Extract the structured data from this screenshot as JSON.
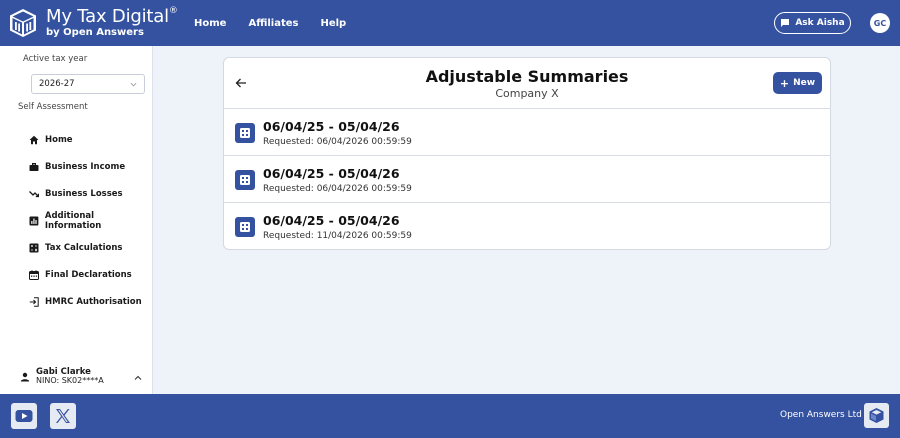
{
  "app": {
    "title": "My Tax Digital",
    "registered": "®",
    "subtitle": "by Open Answers"
  },
  "nav": {
    "items": [
      {
        "label": "Home"
      },
      {
        "label": "Affiliates"
      },
      {
        "label": "Help"
      }
    ]
  },
  "header": {
    "ask_label": "Ask Aisha",
    "user_initials": "GC"
  },
  "sidebar": {
    "tax_year_label": "Active tax year",
    "tax_year_value": "2026-27",
    "section_label": "Self Assessment",
    "items": [
      {
        "label": "Home",
        "icon": "home-icon"
      },
      {
        "label": "Business Income",
        "icon": "briefcase-icon"
      },
      {
        "label": "Business Losses",
        "icon": "trending-down-icon"
      },
      {
        "label": "Additional Information",
        "icon": "bar-chart-icon"
      },
      {
        "label": "Tax Calculations",
        "icon": "calculator-icon"
      },
      {
        "label": "Final Declarations",
        "icon": "calendar-icon"
      },
      {
        "label": "HMRC Authorisation",
        "icon": "login-icon"
      }
    ],
    "user": {
      "name": "Gabi Clarke",
      "nino": "NINO: SK02****A"
    }
  },
  "main": {
    "title": "Adjustable Summaries",
    "subtitle": "Company X",
    "new_button_label": "New",
    "summaries": [
      {
        "period": "06/04/25 - 05/04/26",
        "requested": "Requested: 06/04/2026 00:59:59"
      },
      {
        "period": "06/04/25 - 05/04/26",
        "requested": "Requested: 06/04/2026 00:59:59"
      },
      {
        "period": "06/04/25 - 05/04/26",
        "requested": "Requested: 11/04/2026 00:59:59"
      }
    ]
  },
  "footer": {
    "company": "Open Answers Ltd"
  },
  "colors": {
    "brand": "#3452a0",
    "background": "#eef2f9"
  }
}
